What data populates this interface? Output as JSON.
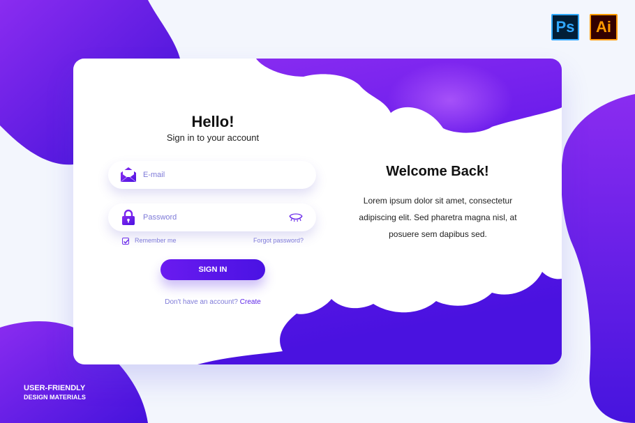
{
  "badges": {
    "photoshop": "Ps",
    "illustrator": "Ai"
  },
  "login": {
    "title": "Hello!",
    "subtitle": "Sign in to your account",
    "email_placeholder": "E-mail",
    "password_placeholder": "Password",
    "remember_label": "Remember me",
    "forgot_label": "Forgot password?",
    "signin_label": "SIGN IN",
    "no_account_text": "Don't have an account?",
    "create_label": "Create",
    "remember_checked": true
  },
  "welcome": {
    "title": "Welcome Back!",
    "text": "Lorem ipsum dolor sit amet, consectetur adipiscing elit. Sed pharetra magna nisl, at posuere sem dapibus sed."
  },
  "footer": {
    "line1": "USER-FRIENDLY",
    "line2": "DESIGN MATERIALS"
  },
  "icons": {
    "email": "envelope-icon",
    "password": "padlock-icon",
    "show_password": "eye-closed-icon",
    "remember": "checkbox-check-icon"
  },
  "colors": {
    "accent": "#5b21e8",
    "accent_light": "#8a2cf0",
    "accent_dark": "#3d10d6",
    "muted_text": "#7e7ad8",
    "background": "#f3f6fd"
  }
}
